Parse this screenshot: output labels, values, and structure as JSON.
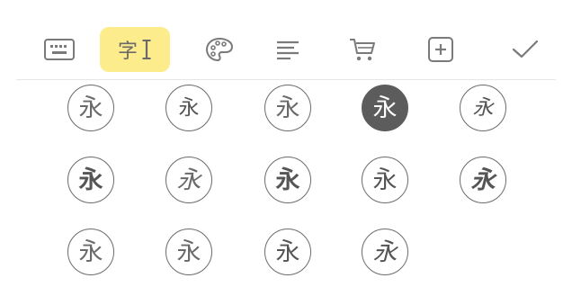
{
  "toolbar": {
    "font_tab_label": "字",
    "tabs": [
      {
        "name": "keyboard",
        "icon": "keyboard-icon"
      },
      {
        "name": "font",
        "icon": "text-cursor-icon",
        "active": true
      },
      {
        "name": "color",
        "icon": "palette-icon"
      },
      {
        "name": "align",
        "icon": "align-left-icon"
      },
      {
        "name": "cart",
        "icon": "cart-icon"
      },
      {
        "name": "add",
        "icon": "plus-square-icon"
      },
      {
        "name": "done",
        "icon": "checkmark-icon"
      }
    ],
    "active_color": "#fcec8c"
  },
  "font_grid": {
    "selected_index": 3,
    "selected_color": "#5c5c5c",
    "items": [
      {
        "glyph": "永"
      },
      {
        "glyph": "永"
      },
      {
        "glyph": "永"
      },
      {
        "glyph": "永"
      },
      {
        "glyph": "永"
      },
      {
        "glyph": "永"
      },
      {
        "glyph": "永"
      },
      {
        "glyph": "永"
      },
      {
        "glyph": "永"
      },
      {
        "glyph": "永"
      },
      {
        "glyph": "永"
      },
      {
        "glyph": "永"
      },
      {
        "glyph": "永"
      },
      {
        "glyph": "永"
      }
    ]
  }
}
